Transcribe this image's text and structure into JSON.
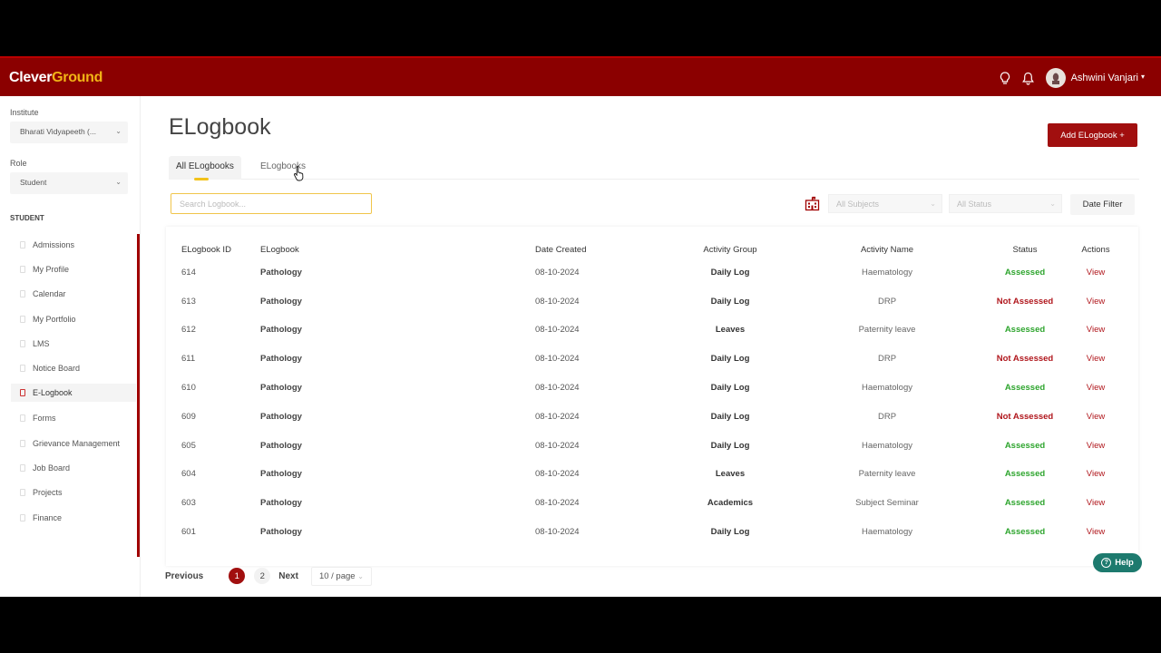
{
  "app": {
    "logo_part1": "Clever",
    "logo_part2": "Ground"
  },
  "header": {
    "user_name": "Ashwini Vanjari",
    "user_caret": "▾",
    "icons": [
      "lightbulb-icon",
      "bell-icon",
      "avatar"
    ]
  },
  "sidebar": {
    "institute_label": "Institute",
    "institute_value": "Bharati Vidyapeeth (...",
    "role_label": "Role",
    "role_value": "Student",
    "section": "STUDENT",
    "items": [
      {
        "label": "Admissions"
      },
      {
        "label": "My Profile"
      },
      {
        "label": "Calendar"
      },
      {
        "label": "My Portfolio"
      },
      {
        "label": "LMS"
      },
      {
        "label": "Notice Board"
      },
      {
        "label": "E-Logbook"
      },
      {
        "label": "Forms"
      },
      {
        "label": "Grievance Management"
      },
      {
        "label": "Job Board"
      },
      {
        "label": "Projects"
      },
      {
        "label": "Finance"
      }
    ],
    "active_item": "E-Logbook"
  },
  "main": {
    "title": "ELogbook",
    "add_button": "Add ELogbook +",
    "tabs": [
      {
        "label": "All ELogbooks"
      },
      {
        "label": "ELogbooks"
      }
    ],
    "search_placeholder": "Search Logbook...",
    "filter_subjects": "All Subjects",
    "filter_status": "All Status",
    "date_filter": "Date Filter"
  },
  "table": {
    "headers": [
      "ELogbook ID",
      "ELogbook",
      "Date Created",
      "Activity Group",
      "Activity Name",
      "Status",
      "Actions"
    ],
    "rows": [
      {
        "id": "614",
        "logbook": "Pathology",
        "date": "08-10-2024",
        "group": "Daily Log",
        "name": "Haematology",
        "status": "Assessed",
        "action": "View"
      },
      {
        "id": "613",
        "logbook": "Pathology",
        "date": "08-10-2024",
        "group": "Daily Log",
        "name": "DRP",
        "status": "Not Assessed",
        "action": "View"
      },
      {
        "id": "612",
        "logbook": "Pathology",
        "date": "08-10-2024",
        "group": "Leaves",
        "name": "Paternity leave",
        "status": "Assessed",
        "action": "View"
      },
      {
        "id": "611",
        "logbook": "Pathology",
        "date": "08-10-2024",
        "group": "Daily Log",
        "name": "DRP",
        "status": "Not Assessed",
        "action": "View"
      },
      {
        "id": "610",
        "logbook": "Pathology",
        "date": "08-10-2024",
        "group": "Daily Log",
        "name": "Haematology",
        "status": "Assessed",
        "action": "View"
      },
      {
        "id": "609",
        "logbook": "Pathology",
        "date": "08-10-2024",
        "group": "Daily Log",
        "name": "DRP",
        "status": "Not Assessed",
        "action": "View"
      },
      {
        "id": "605",
        "logbook": "Pathology",
        "date": "08-10-2024",
        "group": "Daily Log",
        "name": "Haematology",
        "status": "Assessed",
        "action": "View"
      },
      {
        "id": "604",
        "logbook": "Pathology",
        "date": "08-10-2024",
        "group": "Leaves",
        "name": "Paternity leave",
        "status": "Assessed",
        "action": "View"
      },
      {
        "id": "603",
        "logbook": "Pathology",
        "date": "08-10-2024",
        "group": "Academics",
        "name": "Subject Seminar",
        "status": "Assessed",
        "action": "View"
      },
      {
        "id": "601",
        "logbook": "Pathology",
        "date": "08-10-2024",
        "group": "Daily Log",
        "name": "Haematology",
        "status": "Assessed",
        "action": "View"
      }
    ]
  },
  "pagination": {
    "previous": "Previous",
    "pages": [
      "1",
      "2"
    ],
    "current": "1",
    "next": "Next",
    "per_page": "10 / page"
  },
  "help": {
    "label": "Help"
  },
  "colors": {
    "brand": "#8b0000",
    "accent": "#f2b416",
    "assessed": "#2ea52e",
    "not_assessed": "#b0161c",
    "help": "#1d7a6e"
  }
}
